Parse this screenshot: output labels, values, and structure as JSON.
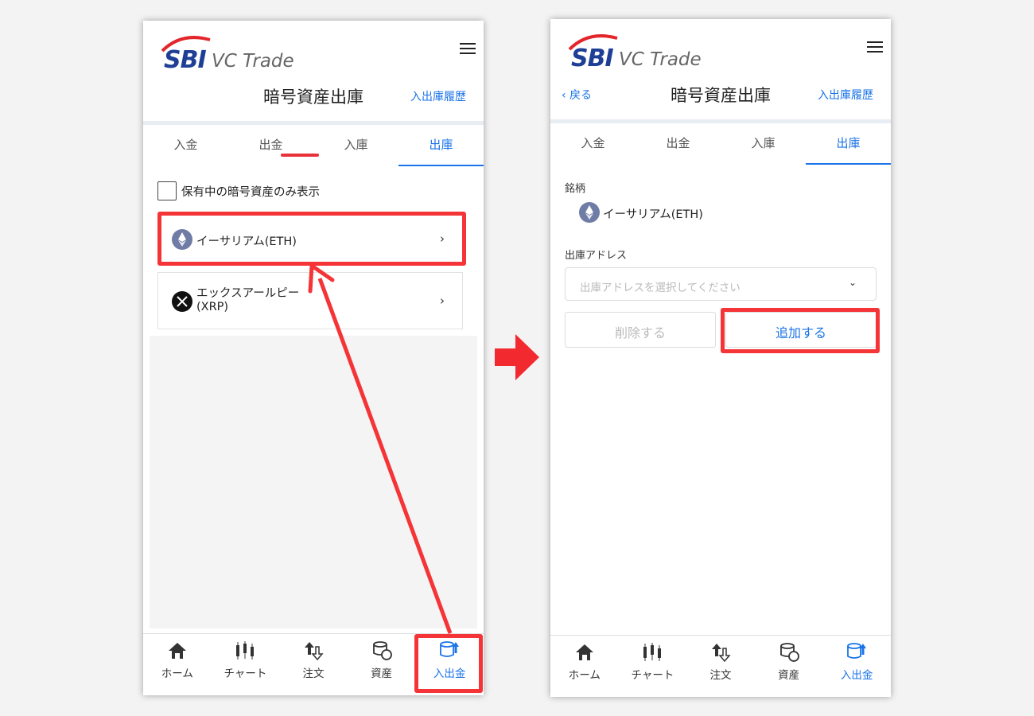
{
  "brand": {
    "sbi": "SBI",
    "vc_trade": "VC Trade"
  },
  "colors": {
    "accent": "#1a73e8",
    "highlight": "#f43437",
    "logo_blue": "#1e3f95"
  },
  "left": {
    "title": "暗号資産出庫",
    "history_link": "入出庫履歴",
    "tabs": [
      "入金",
      "出金",
      "入庫",
      "出庫"
    ],
    "active_tab": "出庫",
    "checkbox_label": "保有中の暗号資産のみ表示",
    "coins": [
      {
        "icon": "ethereum-icon",
        "name": "イーサリアム(ETH)"
      },
      {
        "icon": "xrp-icon",
        "name_line1": "エックスアールピー",
        "name_line2": "(XRP)"
      }
    ]
  },
  "right": {
    "back": "戻る",
    "title": "暗号資産出庫",
    "history_link": "入出庫履歴",
    "tabs": [
      "入金",
      "出金",
      "入庫",
      "出庫"
    ],
    "active_tab": "出庫",
    "symbol_label": "銘柄",
    "symbol_value": "イーサリアム(ETH)",
    "address_label": "出庫アドレス",
    "address_placeholder": "出庫アドレスを選択してください",
    "delete_button": "削除する",
    "add_button": "追加する"
  },
  "nav": [
    {
      "icon": "home-icon",
      "label": "ホーム"
    },
    {
      "icon": "candlestick-chart-icon",
      "label": "チャート"
    },
    {
      "icon": "order-icon",
      "label": "注文"
    },
    {
      "icon": "assets-icon",
      "label": "資産"
    },
    {
      "icon": "deposit-withdraw-icon",
      "label": "入出金"
    }
  ],
  "active_nav": "入出金"
}
